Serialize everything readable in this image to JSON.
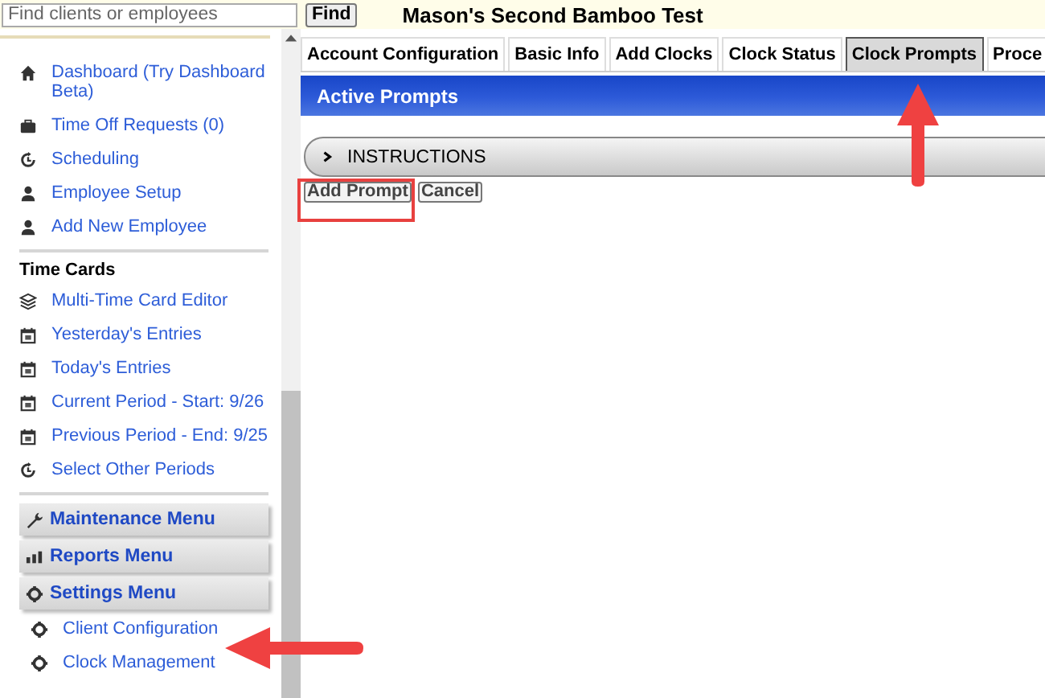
{
  "search": {
    "placeholder": "Find clients or employees",
    "button": "Find"
  },
  "title": "Mason's Second Bamboo Test",
  "sidebar": {
    "items": [
      {
        "kind": "home",
        "label": "Dashboard (Try Dashboard Beta)"
      },
      {
        "kind": "briefcase",
        "label": "Time Off Requests (0)"
      },
      {
        "kind": "clock",
        "label": "Scheduling"
      },
      {
        "kind": "person",
        "label": "Employee Setup"
      },
      {
        "kind": "person",
        "label": "Add New Employee"
      }
    ],
    "time_cards": {
      "heading": "Time Cards",
      "items": [
        {
          "kind": "layers",
          "label": "Multi-Time Card Editor"
        },
        {
          "kind": "calendar",
          "label": "Yesterday's Entries"
        },
        {
          "kind": "calendar",
          "label": "Today's Entries"
        },
        {
          "kind": "calendar",
          "label": "Current Period - Start: 9/26"
        },
        {
          "kind": "calendar",
          "label": "Previous Period - End: 9/25"
        },
        {
          "kind": "clock",
          "label": "Select Other Periods"
        }
      ]
    },
    "menus": [
      {
        "kind": "wrench",
        "label": "Maintenance Menu"
      },
      {
        "kind": "bars",
        "label": "Reports Menu"
      },
      {
        "kind": "gear",
        "label": "Settings Menu"
      }
    ],
    "settings_items": [
      {
        "kind": "gear",
        "label": "Client Configuration"
      },
      {
        "kind": "gear",
        "label": "Clock Management"
      }
    ]
  },
  "tabs": [
    {
      "label": "Account Configuration",
      "selected": false
    },
    {
      "label": "Basic Info",
      "selected": false
    },
    {
      "label": "Add Clocks",
      "selected": false
    },
    {
      "label": "Clock Status",
      "selected": false
    },
    {
      "label": "Clock Prompts",
      "selected": true
    },
    {
      "label": "Proce",
      "selected": false
    }
  ],
  "panel_title": "Active Prompts",
  "instructions": {
    "label": "INSTRUCTIONS",
    "expanded": false
  },
  "buttons": [
    "Add Prompt",
    "Cancel"
  ]
}
